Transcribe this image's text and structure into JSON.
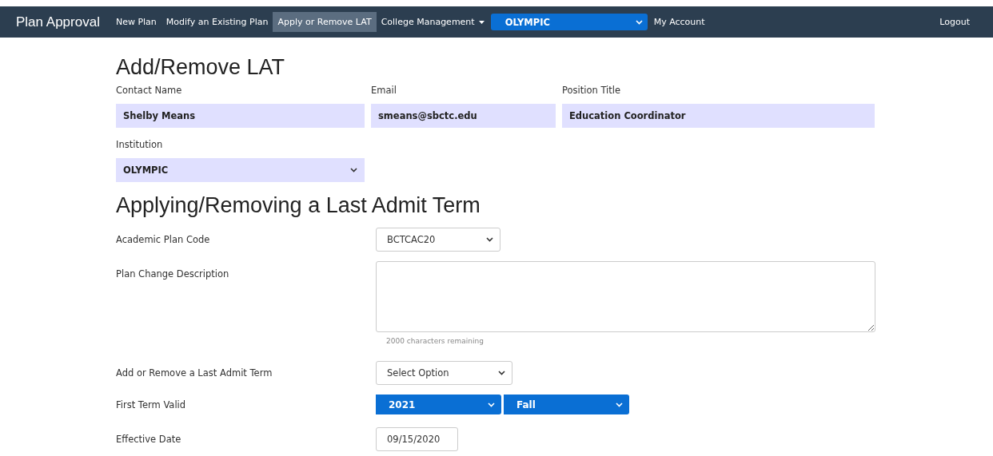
{
  "navbar": {
    "brand": "Plan Approval",
    "items": [
      {
        "kind": "link",
        "label": "New Plan",
        "selected": false
      },
      {
        "kind": "link",
        "label": "Modify an Existing Plan",
        "selected": false
      },
      {
        "kind": "link",
        "label": "Apply or Remove LAT",
        "selected": true
      },
      {
        "kind": "dropdown",
        "label": "College Management",
        "selected": false
      },
      {
        "kind": "select",
        "label": "OLYMPIC"
      },
      {
        "kind": "link",
        "label": "My Account",
        "selected": false
      }
    ],
    "logout": "Logout"
  },
  "contact": {
    "title": "Add/Remove LAT",
    "fields": [
      {
        "label": "Contact Name",
        "value": "Shelby Means"
      },
      {
        "label": "Email",
        "value": "smeans@sbctc.edu"
      },
      {
        "label": "Position Title",
        "value": "Education Coordinator"
      }
    ],
    "institution": {
      "label": "Institution",
      "value": "OLYMPIC"
    }
  },
  "lat": {
    "title": "Applying/Removing a Last Admit Term",
    "rows": [
      {
        "kind": "select",
        "label": "Academic Plan Code",
        "value": "BCTCAC20"
      },
      {
        "kind": "textarea",
        "label": "Plan Change Description",
        "hint": "2000 characters remaining"
      },
      {
        "kind": "select",
        "label": "Add or Remove a Last Admit Term",
        "value": "Select Option"
      },
      {
        "kind": "terms",
        "label": "First Term Valid",
        "values": [
          "2021",
          "Fall"
        ]
      },
      {
        "kind": "date",
        "label": "Effective Date",
        "value": "09/15/2020"
      }
    ]
  }
}
